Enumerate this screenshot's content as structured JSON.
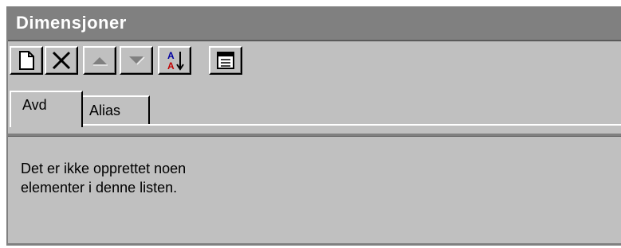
{
  "window": {
    "title": "Dimensjoner"
  },
  "toolbar": {
    "buttons": [
      {
        "icon": "new-document-icon",
        "enabled": true
      },
      {
        "icon": "delete-x-icon",
        "enabled": true
      },
      {
        "icon": "move-up-icon",
        "enabled": false
      },
      {
        "icon": "move-down-icon",
        "enabled": false
      },
      {
        "icon": "sort-az-icon",
        "enabled": true
      },
      {
        "icon": "properties-icon",
        "enabled": true
      }
    ]
  },
  "tabs": [
    {
      "label": "Avd",
      "active": true
    },
    {
      "label": "Alias",
      "active": false
    }
  ],
  "list": {
    "empty_line1": "Det er ikke opprettet noen",
    "empty_line2": "elementer i denne listen."
  },
  "colors": {
    "face": "#c0c0c0",
    "titlebar": "#808080",
    "title_text": "#ffffff",
    "sort_blue": "#0000a0",
    "sort_red": "#c00000"
  }
}
